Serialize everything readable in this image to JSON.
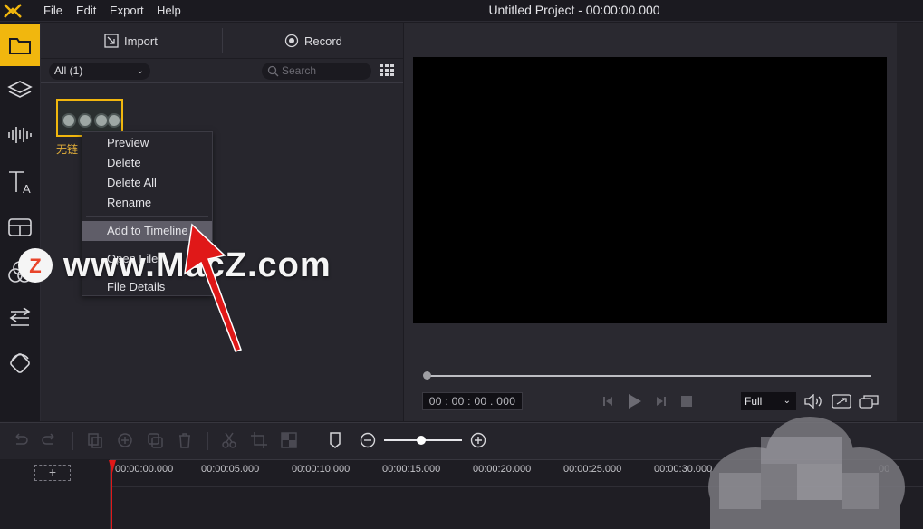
{
  "menubar": {
    "menus": [
      "File",
      "Edit",
      "Export",
      "Help"
    ],
    "window_title": "Untitled Project - 00:00:00.000"
  },
  "rail": {
    "tools": [
      "media-folder-icon",
      "layers-icon",
      "audio-waveform-icon",
      "text-icon",
      "filters-icon",
      "overlays-icon",
      "transitions-icon",
      "elements-icon"
    ],
    "active": "media-folder-icon",
    "accent_color": "#f1b70e"
  },
  "media": {
    "import_label": "Import",
    "record_label": "Record",
    "filter_value": "All (1)",
    "search_placeholder": "Search",
    "clip_caption": "无链"
  },
  "context_menu": {
    "items": [
      "Preview",
      "Delete",
      "Delete All",
      "Rename",
      "Add to Timeline",
      "Open File",
      "File Details"
    ],
    "highlighted": "Add to Timeline"
  },
  "preview": {
    "timecode": "00 : 00 : 00 . 000",
    "zoom_value": "Full",
    "progress": 0
  },
  "timeline": {
    "add_track_label": "+",
    "ticks": [
      "00:00:00.000",
      "00:00:05.000",
      "00:00:10.000",
      "00:00:15.000",
      "00:00:20.000",
      "00:00:25.000",
      "00:00:30.000",
      "00"
    ],
    "playhead_color": "#e01818",
    "zoom_level": 0.45
  },
  "watermark": {
    "badge_letter": "Z",
    "text": "www.MacZ.com"
  }
}
